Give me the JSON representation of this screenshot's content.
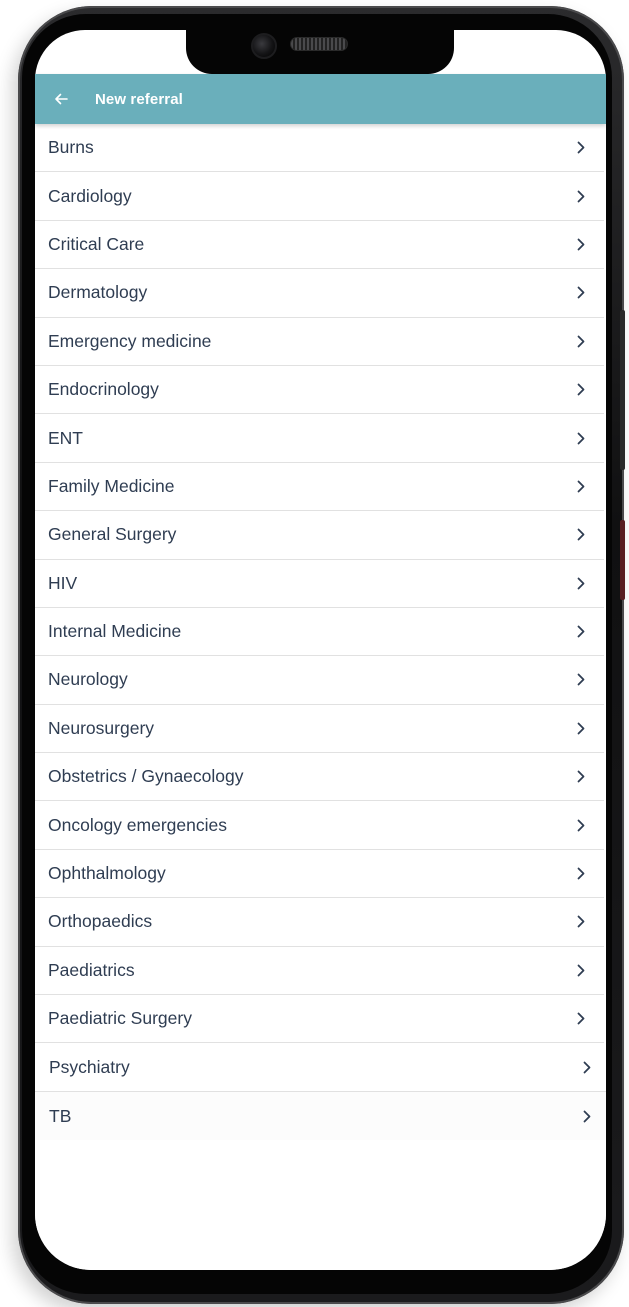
{
  "app_bar": {
    "title": "New referral",
    "color": "#6aafbb"
  },
  "icons": {
    "back": "arrow-left-icon",
    "item_action": "chevron-right-icon"
  },
  "specialties": [
    "Burns",
    "Cardiology",
    "Critical Care",
    "Dermatology",
    "Emergency medicine",
    "Endocrinology",
    "ENT",
    "Family Medicine",
    "General Surgery",
    "HIV",
    "Internal Medicine",
    "Neurology",
    "Neurosurgery",
    "Obstetrics / Gynaecology",
    "Oncology emergencies",
    "Ophthalmology",
    "Orthopaedics",
    "Paediatrics",
    "Paediatric Surgery",
    "Psychiatry",
    "TB"
  ]
}
